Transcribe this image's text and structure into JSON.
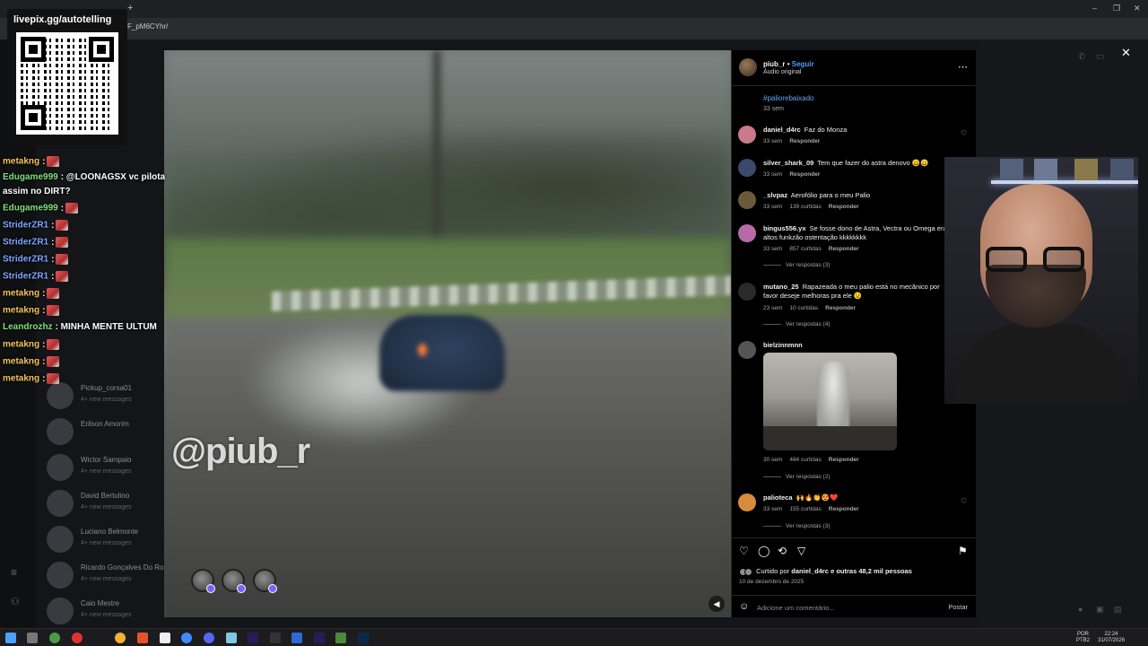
{
  "browser": {
    "url": "F_pM6CYhr/",
    "new_tab": "+",
    "window_controls": [
      "–",
      "❐",
      "✕"
    ]
  },
  "overlay": {
    "qr_title": "livepix.gg/autotelling"
  },
  "chat": [
    {
      "user": "metakng",
      "text": ":",
      "user_color": "#f6c35b",
      "emote": true
    },
    {
      "user": "Edugame999",
      "text": ": @LOONAGSX vc pilota",
      "user_color": "#7fe07f",
      "emote": false
    },
    {
      "user": "",
      "text": "assim no DIRT?",
      "user_color": "#ffffff",
      "emote": false
    },
    {
      "user": "Edugame999",
      "text": ":",
      "user_color": "#7fe07f",
      "emote": true
    },
    {
      "user": "StriderZR1",
      "text": ":",
      "user_color": "#7fa6ff",
      "emote": true
    },
    {
      "user": "StriderZR1",
      "text": ":",
      "user_color": "#7fa6ff",
      "emote": true
    },
    {
      "user": "StriderZR1",
      "text": ":",
      "user_color": "#7fa6ff",
      "emote": true
    },
    {
      "user": "StriderZR1",
      "text": ":",
      "user_color": "#7fa6ff",
      "emote": true
    },
    {
      "user": "metakng",
      "text": ":",
      "user_color": "#f6c35b",
      "emote": true
    },
    {
      "user": "metakng",
      "text": ":",
      "user_color": "#f6c35b",
      "emote": true
    },
    {
      "user": "Leandrozhz",
      "text": ": MINHA MENTE ULTUM",
      "user_color": "#7fe07f",
      "emote": false
    },
    {
      "user": "metakng",
      "text": ":",
      "user_color": "#f6c35b",
      "emote": true
    },
    {
      "user": "metakng",
      "text": ":",
      "user_color": "#f6c35b",
      "emote": true
    },
    {
      "user": "metakng",
      "text": ":",
      "user_color": "#f6c35b",
      "emote": true
    }
  ],
  "background_dms": [
    {
      "name": "Pickup_corsa01",
      "sub": "4+ new messages"
    },
    {
      "name": "Erilson Amorim",
      "sub": ""
    },
    {
      "name": "Wictor Sampaio",
      "sub": "4+ new messages"
    },
    {
      "name": "David Bertulino",
      "sub": "4+ new messages"
    },
    {
      "name": "Luciano Belmonte",
      "sub": "4+ new messages"
    },
    {
      "name": "Ricardo Gonçalves Do Ros",
      "sub": "4+ new messages"
    },
    {
      "name": "Caio Mestre",
      "sub": "4+ new messages"
    }
  ],
  "video": {
    "watermark": "@piub_r"
  },
  "post": {
    "username": "piub_r",
    "separator": "•",
    "follow_label": "Seguir",
    "audio": "Áudio original",
    "hashtag": "#paliorebaixado",
    "hashtag_time": "33 sem",
    "likes_prefix": "Curtido por",
    "likes_user": "daniel_d4rc",
    "likes_suffix": "e outras 48,2 mil pessoas",
    "date": "10 de dezembro de 2025",
    "comment_placeholder": "Adicione um comentário...",
    "post_button": "Postar"
  },
  "comments": [
    {
      "user": "daniel_d4rc",
      "text": "Faz do Monza",
      "time": "33 sem",
      "likes": "",
      "reply": "Responder",
      "replies": "",
      "color": "#c87a8a"
    },
    {
      "user": "silver_shark_09",
      "text": "Tem que fazer do astra denovo 😄😄",
      "time": "33 sem",
      "likes": "",
      "reply": "Responder",
      "replies": "",
      "color": "#3b4a6b"
    },
    {
      "user": "_slvpaz",
      "text": "Aerofólio para o meu Palio",
      "time": "33 sem",
      "likes": "139 curtidas",
      "reply": "Responder",
      "replies": "",
      "color": "#6b5a3a"
    },
    {
      "user": "bingus556.yx",
      "text": "Se fosse dono de Astra, Vectra ou Omega era altos funkzão ostentação kkkkkkkk",
      "time": "33 sem",
      "likes": "857 curtidas",
      "reply": "Responder",
      "replies": "Ver respostas (3)",
      "color": "#b86aa8"
    },
    {
      "user": "mutano_25",
      "text": "Rapazeada o meu palio está no mecânico por favor deseje melhoras pra ele 😉",
      "time": "23 sem",
      "likes": "10 curtidas",
      "reply": "Responder",
      "replies": "Ver respostas (4)",
      "color": "#2a2a2a"
    },
    {
      "user": "bielzinnmnn",
      "text": "",
      "time": "30 sem",
      "likes": "484 curtidas",
      "reply": "Responder",
      "replies": "Ver respostas (2)",
      "color": "#555"
    },
    {
      "user": "palioteca",
      "text": "🙌🔥👏😍❤️",
      "time": "33 sem",
      "likes": "155 curtidas",
      "reply": "Responder",
      "replies": "Ver respostas (3)",
      "color": "#d98a3a"
    }
  ],
  "taskbar": {
    "lang": "POR",
    "lang2": "PTB2",
    "time": "22:24",
    "date": "31/07/2026"
  },
  "colors": {
    "ig_link": "#4c9dff",
    "ig_bg": "#000000"
  }
}
